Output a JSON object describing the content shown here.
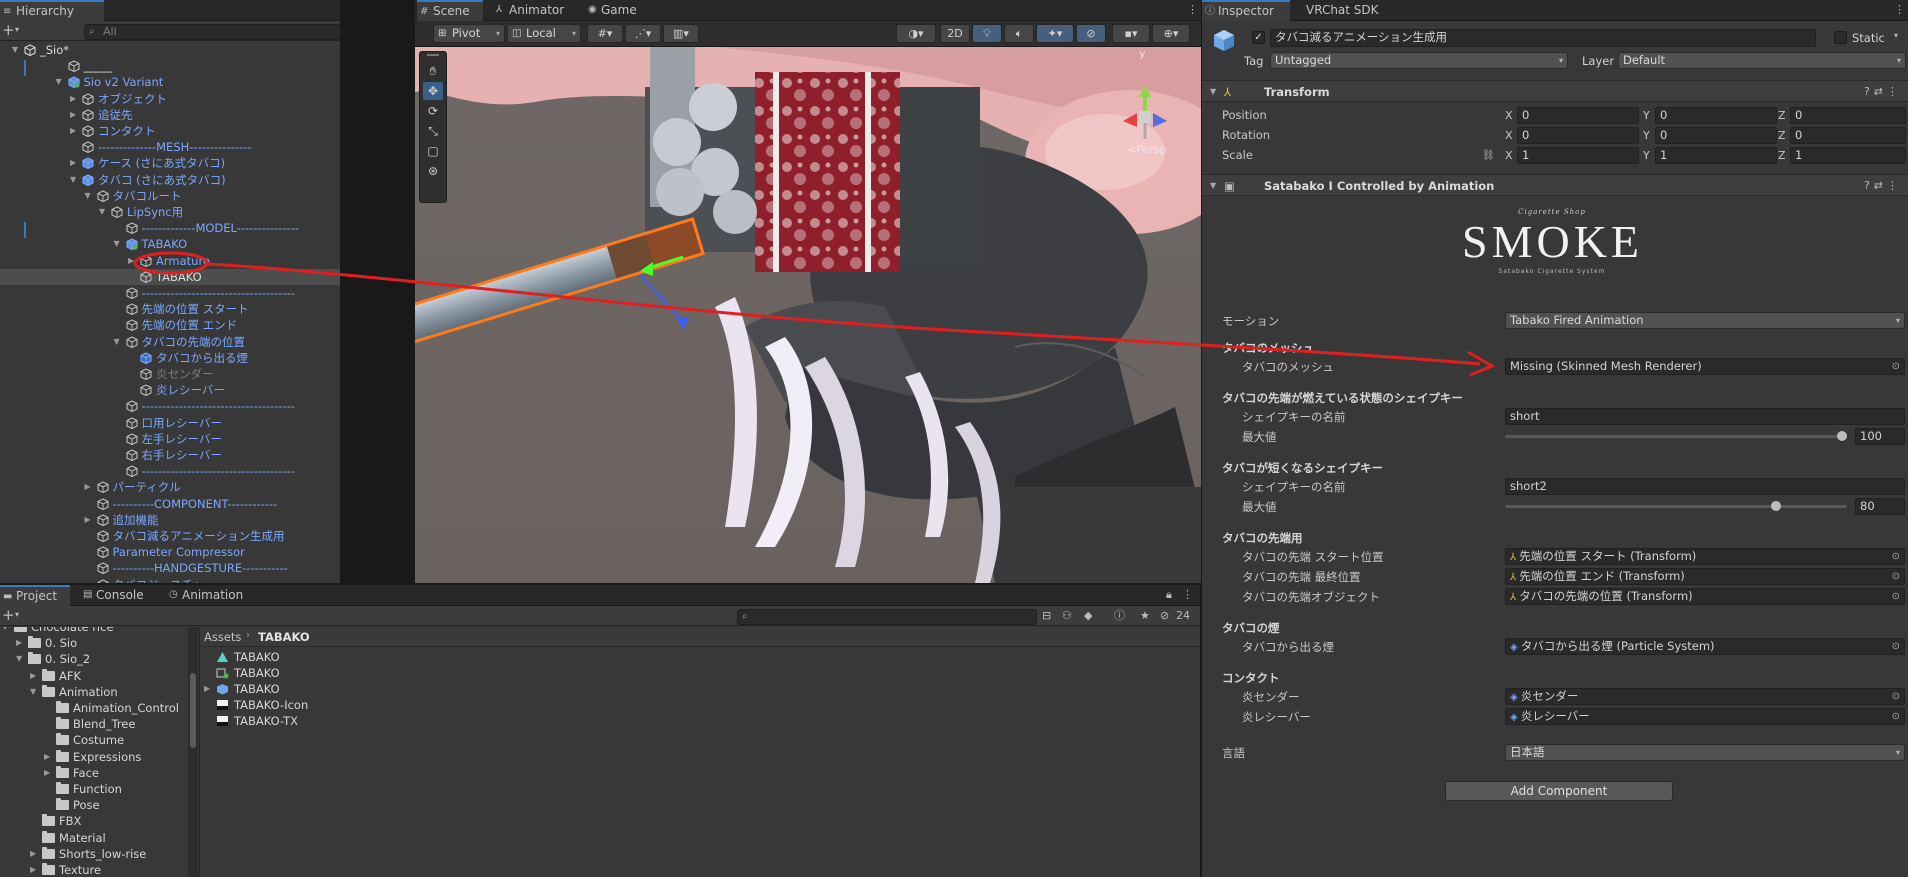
{
  "colors": {
    "accent": "#3a79bb",
    "prefab_blue": "#7aa8ff",
    "annotation_red": "#e02020",
    "selection_orange": "#ff7a1a"
  },
  "hierarchy": {
    "tab": "Hierarchy",
    "search_placeholder": "All",
    "rows": [
      {
        "label": "_Sio*",
        "indent": 0,
        "expanded": true,
        "color": "white",
        "icon": "unity-scene-icon",
        "kebab": true
      },
      {
        "label": "_____",
        "indent": 3,
        "color": "white",
        "icon": "gameobject-icon"
      },
      {
        "label": "Sio v2 Variant",
        "indent": 3,
        "expanded": true,
        "color": "blue",
        "icon": "prefab-variant-icon",
        "chevron": true
      },
      {
        "label": "オブジェクト",
        "indent": 4,
        "collapsed": true,
        "color": "blue",
        "icon": "gameobject-icon"
      },
      {
        "label": "追従先",
        "indent": 4,
        "collapsed": true,
        "color": "blue",
        "icon": "gameobject-icon"
      },
      {
        "label": "コンタクト",
        "indent": 4,
        "collapsed": true,
        "color": "blue",
        "icon": "gameobject-icon"
      },
      {
        "label": "--------------MESH---------------",
        "indent": 4,
        "color": "blue",
        "icon": "gameobject-icon"
      },
      {
        "label": "ケース (さにあ式タバコ)",
        "indent": 4,
        "collapsed": true,
        "color": "blue",
        "icon": "prefab-icon",
        "chevron": true
      },
      {
        "label": "タバコ (さにあ式タバコ)",
        "indent": 4,
        "expanded": true,
        "color": "blue",
        "icon": "prefab-icon",
        "chevron": true
      },
      {
        "label": "タバコルート",
        "indent": 5,
        "expanded": true,
        "color": "blue",
        "icon": "gameobject-icon"
      },
      {
        "label": "LipSync用",
        "indent": 6,
        "expanded": true,
        "color": "blue",
        "icon": "gameobject-icon"
      },
      {
        "label": "-------------MODEL---------------",
        "indent": 7,
        "color": "blue",
        "icon": "gameobject-icon"
      },
      {
        "label": "TABAKO",
        "indent": 7,
        "expanded": true,
        "color": "blue",
        "icon": "prefab-variant-icon"
      },
      {
        "label": "Armature",
        "indent": 8,
        "collapsed": true,
        "color": "blue",
        "icon": "gameobject-icon"
      },
      {
        "label": "TABAKO",
        "indent": 8,
        "color": "white",
        "icon": "gameobject-icon",
        "selected": true
      },
      {
        "label": "-------------------------------------",
        "indent": 7,
        "color": "blue",
        "icon": "gameobject-icon"
      },
      {
        "label": "先端の位置 スタート",
        "indent": 7,
        "color": "blue",
        "icon": "gameobject-icon"
      },
      {
        "label": "先端の位置 エンド",
        "indent": 7,
        "color": "blue",
        "icon": "gameobject-icon"
      },
      {
        "label": "タバコの先端の位置",
        "indent": 7,
        "expanded": true,
        "color": "blue",
        "icon": "gameobject-icon"
      },
      {
        "label": "タバコから出る煙",
        "indent": 8,
        "color": "blue",
        "icon": "particle-icon",
        "chevron": true
      },
      {
        "label": "炎センダー",
        "indent": 8,
        "color": "gray",
        "icon": "gameobject-icon"
      },
      {
        "label": "炎レシーバー",
        "indent": 8,
        "color": "blue",
        "icon": "gameobject-icon"
      },
      {
        "label": "-------------------------------------",
        "indent": 7,
        "color": "blue",
        "icon": "gameobject-icon"
      },
      {
        "label": "口用レシーバー",
        "indent": 7,
        "color": "blue",
        "icon": "gameobject-icon"
      },
      {
        "label": "左手レシーバー",
        "indent": 7,
        "color": "blue",
        "icon": "gameobject-icon"
      },
      {
        "label": "右手レシーバー",
        "indent": 7,
        "color": "blue",
        "icon": "gameobject-icon"
      },
      {
        "label": "-------------------------------------",
        "indent": 7,
        "color": "blue",
        "icon": "gameobject-icon"
      },
      {
        "label": "パーティクル",
        "indent": 5,
        "collapsed": true,
        "color": "blue",
        "icon": "gameobject-icon"
      },
      {
        "label": "----------COMPONENT------------",
        "indent": 5,
        "color": "blue",
        "icon": "gameobject-icon"
      },
      {
        "label": "追加機能",
        "indent": 5,
        "collapsed": true,
        "color": "blue",
        "icon": "gameobject-icon"
      },
      {
        "label": "タバコ減るアニメーション生成用",
        "indent": 5,
        "color": "blue",
        "icon": "gameobject-icon"
      },
      {
        "label": "Parameter Compressor",
        "indent": 5,
        "color": "blue",
        "icon": "gameobject-icon"
      },
      {
        "label": "----------HANDGESTURE-----------",
        "indent": 5,
        "color": "blue",
        "icon": "gameobject-icon"
      },
      {
        "label": "タバコジェスチャー",
        "indent": 5,
        "color": "blue",
        "icon": "gameobject-icon"
      },
      {
        "label": "ライター (さにあ式タバコ)",
        "indent": 4,
        "collapsed": true,
        "color": "blue",
        "icon": "prefab-icon"
      }
    ]
  },
  "scene": {
    "tabs": [
      {
        "label": "Scene",
        "icon": "grid-icon",
        "active": true
      },
      {
        "label": "Animator",
        "icon": "animator-icon"
      },
      {
        "label": "Game",
        "icon": "gamepad-icon"
      }
    ],
    "pivot_label": "Pivot",
    "local_label": "Local",
    "mode_2d_label": "2D",
    "gizmo_y": "y",
    "gizmo_persp": "<Persp"
  },
  "inspector": {
    "tabs": [
      {
        "label": "Inspector",
        "active": true
      },
      {
        "label": "VRChat SDK"
      }
    ],
    "object_name": "タバコ減るアニメーション生成用",
    "static_label": "Static",
    "tag_label": "Tag",
    "tag_value": "Untagged",
    "layer_label": "Layer",
    "layer_value": "Default",
    "transform": {
      "title": "Transform",
      "position_label": "Position",
      "position": {
        "x": "0",
        "y": "0",
        "z": "0"
      },
      "rotation_label": "Rotation",
      "rotation": {
        "x": "0",
        "y": "0",
        "z": "0"
      },
      "scale_label": "Scale",
      "scale": {
        "x": "1",
        "y": "1",
        "z": "1"
      },
      "axis_x": "X",
      "axis_y": "Y",
      "axis_z": "Z"
    },
    "component": {
      "title": "Satabako I Controlled by Animation",
      "logo_small": "Cigarette Shop",
      "logo_main": "SMOKE",
      "logo_tagline": "Satabako Cigarette System",
      "motion_label": "モーション",
      "motion_value": "Tabako Fired Animation",
      "mesh_group": "タバコのメッシュ",
      "mesh_label": "タバコのメッシュ",
      "mesh_value": "Missing (Skinned Mesh Renderer)",
      "burn_group": "タバコの先端が燃えている状態のシェイプキー",
      "burn_name_label": "シェイプキーの名前",
      "burn_name_value": "short",
      "burn_max_label": "最大値",
      "burn_max_value": 100,
      "short_group": "タバコが短くなるシェイプキー",
      "short_name_label": "シェイプキーの名前",
      "short_name_value": "short2",
      "short_max_label": "最大値",
      "short_max_value": 80,
      "slider_range": [
        0,
        100
      ],
      "tip_group": "タバコの先端用",
      "tip_start_label": "タバコの先端 スタート位置",
      "tip_start_value": "先端の位置 スタート (Transform)",
      "tip_end_label": "タバコの先端 最終位置",
      "tip_end_value": "先端の位置 エンド (Transform)",
      "tip_obj_label": "タバコの先端オブジェクト",
      "tip_obj_value": "タバコの先端の位置 (Transform)",
      "smoke_group": "タバコの煙",
      "smoke_label": "タバコから出る煙",
      "smoke_value": "タバコから出る煙 (Particle System)",
      "contact_group": "コンタクト",
      "sender_label": "炎センダー",
      "sender_value": "炎センダー",
      "receiver_label": "炎レシーバー",
      "receiver_value": "炎レシーバー",
      "lang_label": "言語",
      "lang_value": "日本語"
    },
    "add_component_label": "Add Component"
  },
  "project": {
    "tabs": [
      {
        "label": "Project",
        "icon": "folder-icon",
        "active": true
      },
      {
        "label": "Console",
        "icon": "console-icon"
      },
      {
        "label": "Animation",
        "icon": "animation-icon"
      }
    ],
    "hidden_count": "24",
    "breadcrumb": [
      "Assets",
      "TABAKO"
    ],
    "tree": [
      {
        "label": "Chocolate rice",
        "indent": 1,
        "expanded": true
      },
      {
        "label": "0. Sio",
        "indent": 2,
        "collapsed": true
      },
      {
        "label": "0. Sio_2",
        "indent": 2,
        "expanded": true
      },
      {
        "label": "AFK",
        "indent": 3,
        "collapsed": true
      },
      {
        "label": "Animation",
        "indent": 3,
        "expanded": true
      },
      {
        "label": "Animation_Control",
        "indent": 4
      },
      {
        "label": "Blend_Tree",
        "indent": 4
      },
      {
        "label": "Costume",
        "indent": 4
      },
      {
        "label": "Expressions",
        "indent": 4,
        "collapsed": true
      },
      {
        "label": "Face",
        "indent": 4,
        "collapsed": true
      },
      {
        "label": "Function",
        "indent": 4
      },
      {
        "label": "Pose",
        "indent": 4
      },
      {
        "label": "FBX",
        "indent": 3
      },
      {
        "label": "Material",
        "indent": 3
      },
      {
        "label": "Shorts_low-rise",
        "indent": 3,
        "collapsed": true
      },
      {
        "label": "Texture",
        "indent": 3,
        "collapsed": true
      }
    ],
    "assets": [
      {
        "label": "TABAKO",
        "icon": "mesh-icon"
      },
      {
        "label": "TABAKO",
        "icon": "prefab-variant-icon"
      },
      {
        "label": "TABAKO",
        "icon": "model-icon",
        "expandable": true
      },
      {
        "label": "TABAKO-Icon",
        "icon": "texture-icon"
      },
      {
        "label": "TABAKO-TX",
        "icon": "texture-icon"
      }
    ]
  }
}
